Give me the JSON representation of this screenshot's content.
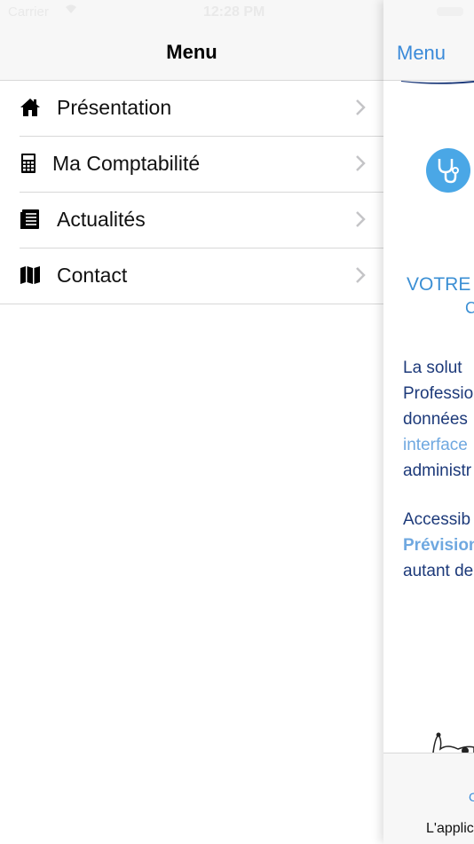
{
  "status_bar": {
    "carrier": "Carrier",
    "time": "12:28 PM"
  },
  "menu": {
    "title": "Menu",
    "items": [
      {
        "label": "Présentation",
        "icon": "home-icon"
      },
      {
        "label": "Ma Comptabilité",
        "icon": "calculator-icon"
      },
      {
        "label": "Actualités",
        "icon": "newspaper-icon"
      },
      {
        "label": "Contact",
        "icon": "map-icon"
      }
    ]
  },
  "content": {
    "back_label": "Menu",
    "heading": "VOTRE",
    "subheading": "C",
    "para1": [
      "La solut",
      "Professio",
      "données",
      "interface",
      "administr"
    ],
    "para2": [
      "Accessib",
      "Prévision",
      "autant de"
    ],
    "footer_link": "C",
    "footer_text": "L'applic"
  },
  "colors": {
    "accent": "#3a8ad9",
    "logo": "#4aa7e6",
    "text_dark": "#1d3a7a"
  }
}
